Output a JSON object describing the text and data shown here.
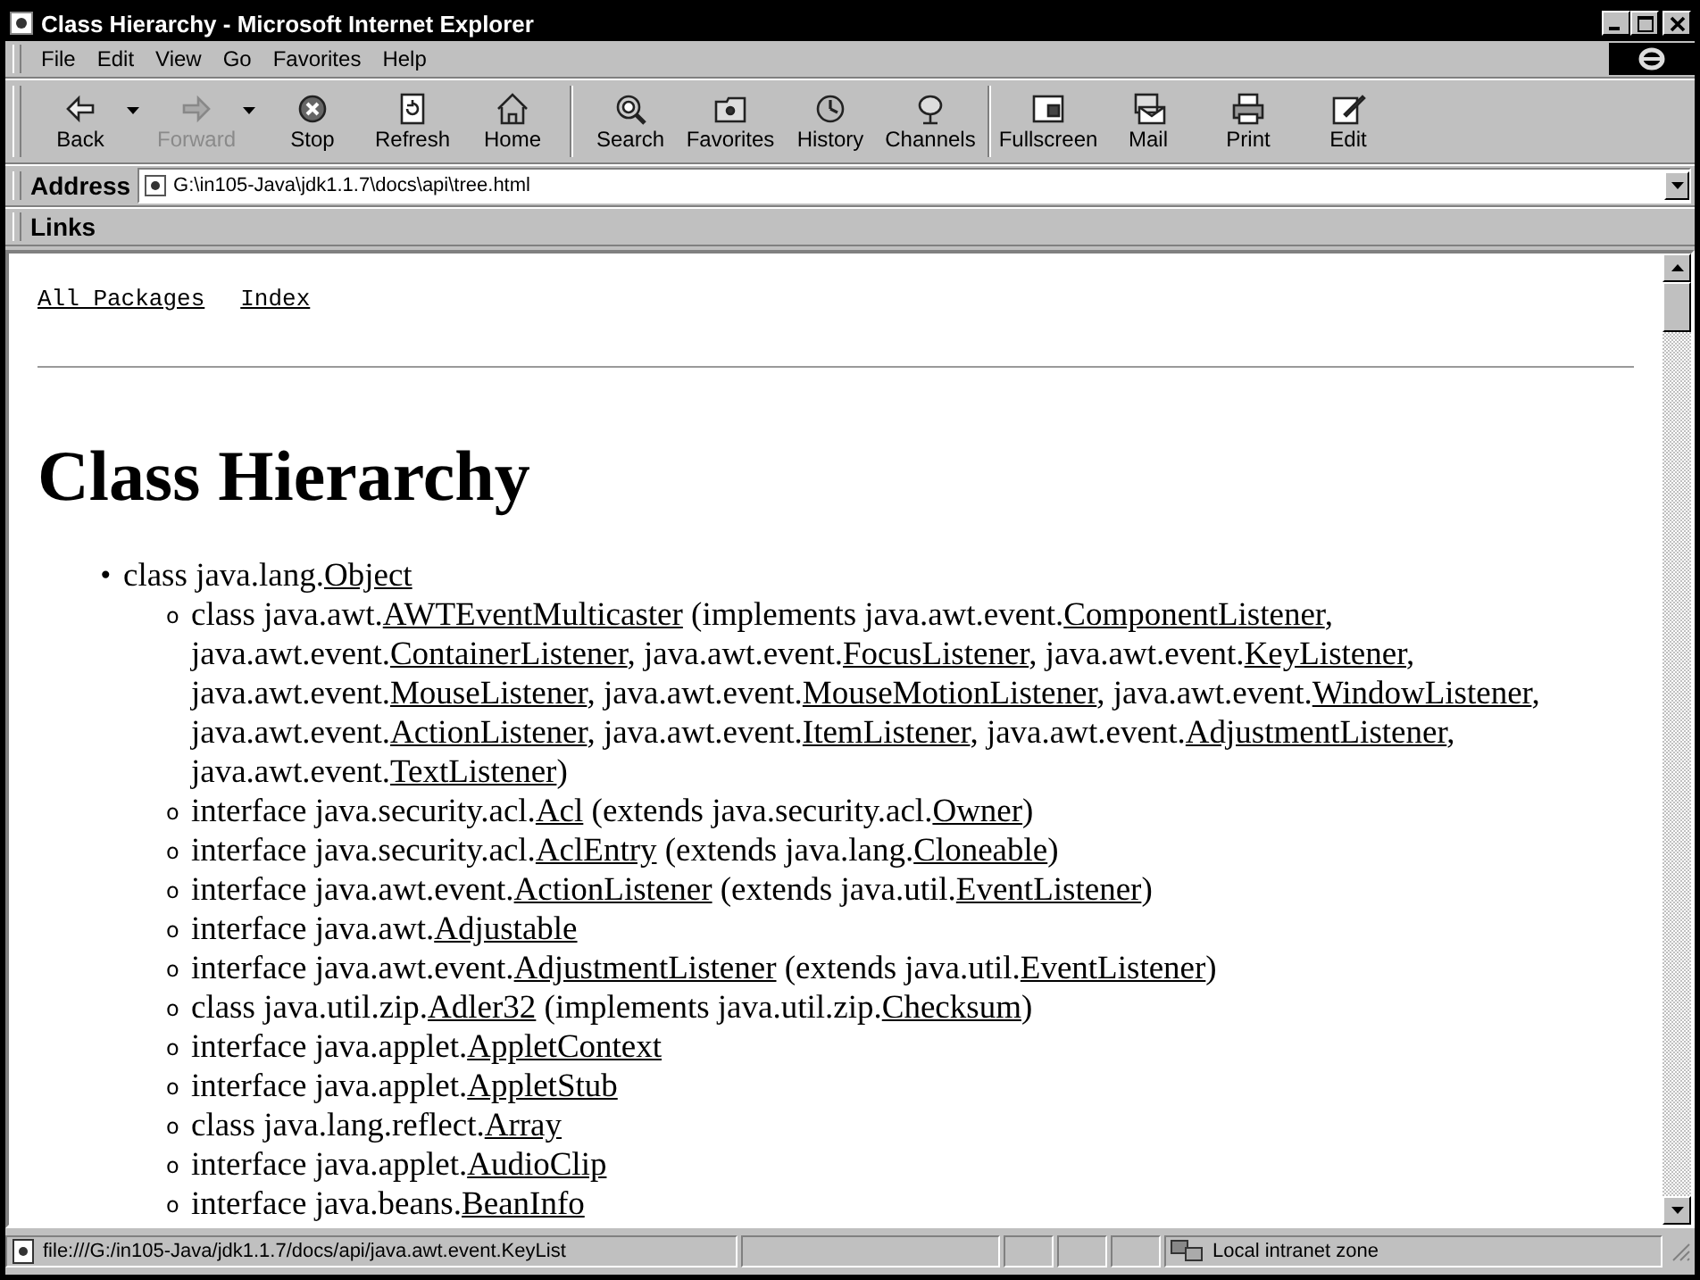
{
  "window": {
    "title": "Class Hierarchy - Microsoft Internet Explorer"
  },
  "menu": [
    "File",
    "Edit",
    "View",
    "Go",
    "Favorites",
    "Help"
  ],
  "toolbar": [
    {
      "label": "Back",
      "disabled": false,
      "dropdown": true
    },
    {
      "label": "Forward",
      "disabled": true,
      "dropdown": true
    },
    {
      "label": "Stop",
      "disabled": false,
      "dropdown": false
    },
    {
      "label": "Refresh",
      "disabled": false,
      "dropdown": false
    },
    {
      "label": "Home",
      "disabled": false,
      "dropdown": false
    },
    {
      "label": "Search",
      "disabled": false,
      "dropdown": false
    },
    {
      "label": "Favorites",
      "disabled": false,
      "dropdown": false
    },
    {
      "label": "History",
      "disabled": false,
      "dropdown": false
    },
    {
      "label": "Channels",
      "disabled": false,
      "dropdown": false
    },
    {
      "label": "Fullscreen",
      "disabled": false,
      "dropdown": false
    },
    {
      "label": "Mail",
      "disabled": false,
      "dropdown": false
    },
    {
      "label": "Print",
      "disabled": false,
      "dropdown": false
    },
    {
      "label": "Edit",
      "disabled": false,
      "dropdown": false
    }
  ],
  "address": {
    "label": "Address",
    "value": "G:\\in105-Java\\jdk1.1.7\\docs\\api\\tree.html"
  },
  "links_bar": {
    "label": "Links"
  },
  "page": {
    "nav": [
      "All Packages",
      "Index"
    ],
    "heading": "Class Hierarchy",
    "tree": [
      {
        "marker": "•",
        "segments": [
          {
            "kind": "text",
            "text": "class java.lang."
          },
          {
            "kind": "link",
            "text": "Object"
          }
        ],
        "children": [
          {
            "marker": "o",
            "segments": [
              {
                "kind": "text",
                "text": "class java.awt."
              },
              {
                "kind": "link",
                "text": "AWTEventMulticaster"
              },
              {
                "kind": "text",
                "text": " (implements java.awt.event."
              },
              {
                "kind": "link",
                "text": "ComponentListener"
              },
              {
                "kind": "text",
                "text": ", java.awt.event."
              },
              {
                "kind": "link",
                "text": "ContainerListener"
              },
              {
                "kind": "text",
                "text": ", java.awt.event."
              },
              {
                "kind": "link",
                "text": "FocusListener"
              },
              {
                "kind": "text",
                "text": ", java.awt.event."
              },
              {
                "kind": "link",
                "text": "KeyListener"
              },
              {
                "kind": "text",
                "text": ", java.awt.event."
              },
              {
                "kind": "link",
                "text": "MouseListener"
              },
              {
                "kind": "text",
                "text": ", java.awt.event."
              },
              {
                "kind": "link",
                "text": "MouseMotionListener"
              },
              {
                "kind": "text",
                "text": ", java.awt.event."
              },
              {
                "kind": "link",
                "text": "WindowListener"
              },
              {
                "kind": "text",
                "text": ", java.awt.event."
              },
              {
                "kind": "link",
                "text": "ActionListener"
              },
              {
                "kind": "text",
                "text": ", java.awt.event."
              },
              {
                "kind": "link",
                "text": "ItemListener"
              },
              {
                "kind": "text",
                "text": ", java.awt.event."
              },
              {
                "kind": "link",
                "text": "AdjustmentListener"
              },
              {
                "kind": "text",
                "text": ", java.awt.event."
              },
              {
                "kind": "link",
                "text": "TextListener"
              },
              {
                "kind": "text",
                "text": ")"
              }
            ]
          },
          {
            "marker": "o",
            "segments": [
              {
                "kind": "text",
                "text": "interface java.security.acl."
              },
              {
                "kind": "link",
                "text": "Acl"
              },
              {
                "kind": "text",
                "text": " (extends java.security.acl."
              },
              {
                "kind": "link",
                "text": "Owner"
              },
              {
                "kind": "text",
                "text": ")"
              }
            ]
          },
          {
            "marker": "o",
            "segments": [
              {
                "kind": "text",
                "text": "interface java.security.acl."
              },
              {
                "kind": "link",
                "text": "AclEntry"
              },
              {
                "kind": "text",
                "text": " (extends java.lang."
              },
              {
                "kind": "link",
                "text": "Cloneable"
              },
              {
                "kind": "text",
                "text": ")"
              }
            ]
          },
          {
            "marker": "o",
            "segments": [
              {
                "kind": "text",
                "text": "interface java.awt.event."
              },
              {
                "kind": "link",
                "text": "ActionListener"
              },
              {
                "kind": "text",
                "text": " (extends java.util."
              },
              {
                "kind": "link",
                "text": "EventListener"
              },
              {
                "kind": "text",
                "text": ")"
              }
            ]
          },
          {
            "marker": "o",
            "segments": [
              {
                "kind": "text",
                "text": "interface java.awt."
              },
              {
                "kind": "link",
                "text": "Adjustable"
              }
            ]
          },
          {
            "marker": "o",
            "segments": [
              {
                "kind": "text",
                "text": "interface java.awt.event."
              },
              {
                "kind": "link",
                "text": "AdjustmentListener"
              },
              {
                "kind": "text",
                "text": " (extends java.util."
              },
              {
                "kind": "link",
                "text": "EventListener"
              },
              {
                "kind": "text",
                "text": ")"
              }
            ]
          },
          {
            "marker": "o",
            "segments": [
              {
                "kind": "text",
                "text": "class java.util.zip."
              },
              {
                "kind": "link",
                "text": "Adler32"
              },
              {
                "kind": "text",
                "text": " (implements java.util.zip."
              },
              {
                "kind": "link",
                "text": "Checksum"
              },
              {
                "kind": "text",
                "text": ")"
              }
            ]
          },
          {
            "marker": "o",
            "segments": [
              {
                "kind": "text",
                "text": "interface java.applet."
              },
              {
                "kind": "link",
                "text": "AppletContext"
              }
            ]
          },
          {
            "marker": "o",
            "segments": [
              {
                "kind": "text",
                "text": "interface java.applet."
              },
              {
                "kind": "link",
                "text": "AppletStub"
              }
            ]
          },
          {
            "marker": "o",
            "segments": [
              {
                "kind": "text",
                "text": "class java.lang.reflect."
              },
              {
                "kind": "link",
                "text": "Array"
              }
            ]
          },
          {
            "marker": "o",
            "segments": [
              {
                "kind": "text",
                "text": "interface java.applet."
              },
              {
                "kind": "link",
                "text": "AudioClip"
              }
            ]
          },
          {
            "marker": "o",
            "segments": [
              {
                "kind": "text",
                "text": "interface java.beans."
              },
              {
                "kind": "link",
                "text": "BeanInfo"
              }
            ]
          }
        ]
      }
    ]
  },
  "status_bar": {
    "text": "file:///G:/in105-Java/jdk1.1.7/docs/api/java.awt.event.KeyList",
    "zone": "Local intranet zone"
  }
}
